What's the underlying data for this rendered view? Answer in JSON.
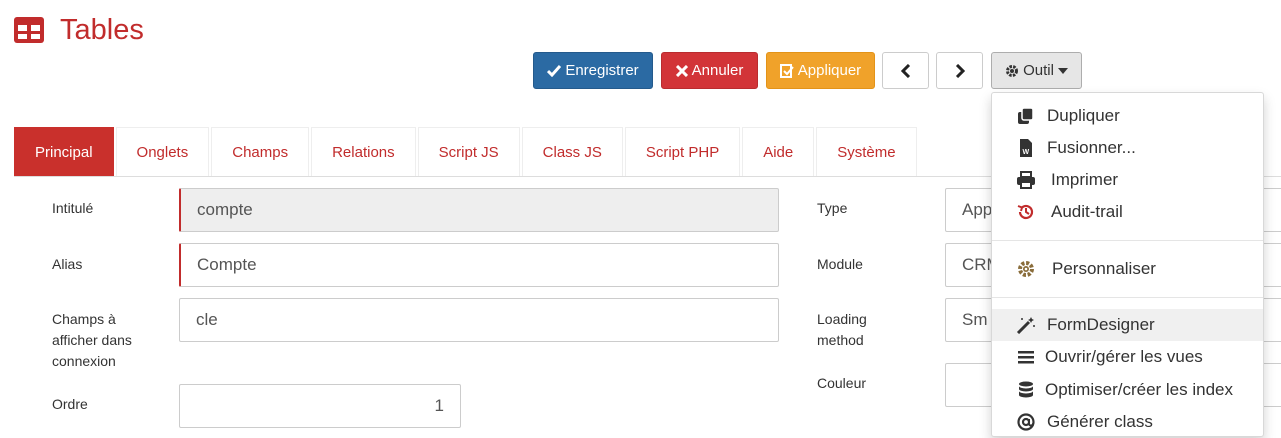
{
  "header": {
    "title": "Tables",
    "logo_icon": "table-icon"
  },
  "toolbar": {
    "save_label": "Enregistrer",
    "cancel_label": "Annuler",
    "apply_label": "Appliquer",
    "prev_icon": "chevron-left-icon",
    "next_icon": "chevron-right-icon",
    "tools_label": "Outil"
  },
  "tabs": [
    {
      "label": "Principal",
      "active": true
    },
    {
      "label": "Onglets"
    },
    {
      "label": "Champs"
    },
    {
      "label": "Relations"
    },
    {
      "label": "Script JS"
    },
    {
      "label": "Class JS"
    },
    {
      "label": "Script PHP"
    },
    {
      "label": "Aide"
    },
    {
      "label": "Système"
    }
  ],
  "form": {
    "intitule": {
      "label": "Intitulé",
      "value": "compte"
    },
    "alias": {
      "label": "Alias",
      "value": "Compte"
    },
    "champs": {
      "label_lines": [
        "Champs à",
        "afficher dans",
        "connexion"
      ],
      "value": "cle"
    },
    "ordre": {
      "label": "Ordre",
      "value": "1"
    },
    "type": {
      "label": "Type",
      "value": "App"
    },
    "module": {
      "label": "Module",
      "value": "CRM"
    },
    "loading": {
      "label_lines": [
        "Loading",
        "method"
      ],
      "value": "Sm"
    },
    "couleur": {
      "label": "Couleur",
      "value": ""
    }
  },
  "tools_menu": {
    "items": [
      {
        "label": "Dupliquer",
        "icon": "copy-icon"
      },
      {
        "label": "Fusionner...",
        "icon": "word-file-icon"
      },
      {
        "label": "Imprimer",
        "icon": "print-icon"
      },
      {
        "label": "Audit-trail",
        "icon": "history-icon"
      },
      {
        "label": "Personnaliser",
        "icon": "gear-icon"
      },
      {
        "label": "FormDesigner",
        "icon": "magic-wand-icon"
      },
      {
        "label": "Ouvrir/gérer les vues",
        "icon": "list-icon"
      },
      {
        "label": "Optimiser/créer les index",
        "icon": "database-icon"
      },
      {
        "label": "Générer class",
        "icon": "at-icon"
      }
    ]
  }
}
